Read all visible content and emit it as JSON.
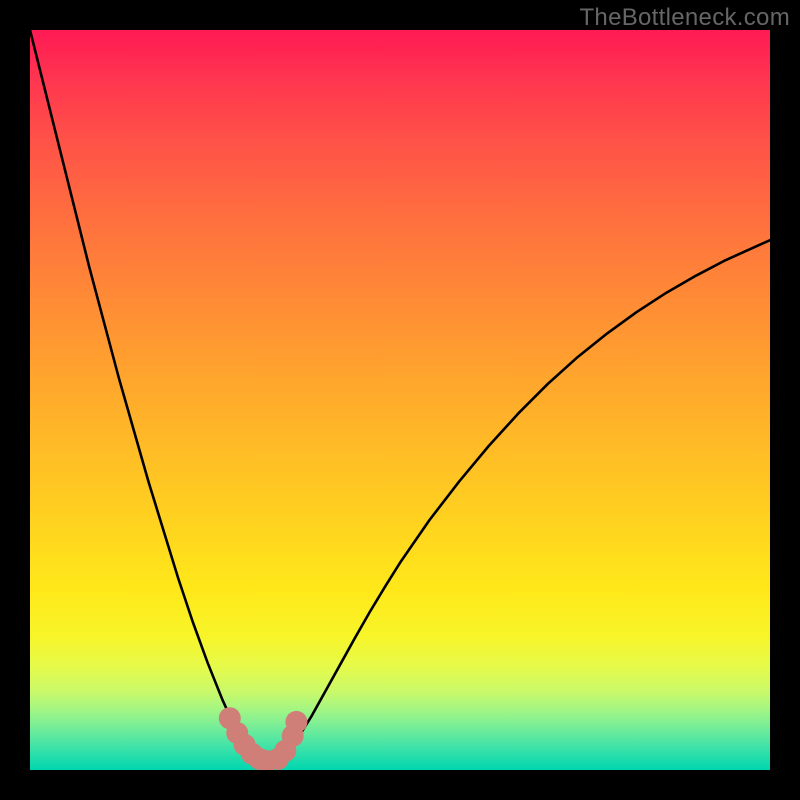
{
  "attribution": "TheBottleneck.com",
  "chart_data": {
    "type": "line",
    "title": "",
    "xlabel": "",
    "ylabel": "",
    "xlim": [
      0,
      100
    ],
    "ylim": [
      0,
      100
    ],
    "x": [
      0,
      2,
      4,
      6,
      8,
      10,
      12,
      14,
      16,
      18,
      20,
      22,
      24,
      25,
      26,
      27,
      28,
      29,
      30,
      31,
      32,
      33,
      34,
      36,
      38,
      40,
      42,
      44,
      46,
      48,
      50,
      54,
      58,
      62,
      66,
      70,
      74,
      78,
      82,
      86,
      90,
      94,
      98,
      100
    ],
    "y": [
      100,
      92,
      84,
      76,
      68,
      60.5,
      53,
      46,
      39,
      32.5,
      26,
      20,
      14.5,
      12,
      9.5,
      7.3,
      5.4,
      3.8,
      2.6,
      1.7,
      1.2,
      1.2,
      1.8,
      4.0,
      7.2,
      10.8,
      14.4,
      18.0,
      21.5,
      24.8,
      28.0,
      33.8,
      39.0,
      43.8,
      48.2,
      52.2,
      55.8,
      59.0,
      61.9,
      64.5,
      66.8,
      68.9,
      70.7,
      71.6
    ],
    "series_color": "#000000",
    "markers": {
      "color": "#cf7f78",
      "points": [
        {
          "x": 27,
          "y": 7.0
        },
        {
          "x": 28,
          "y": 5.0
        },
        {
          "x": 29,
          "y": 3.4
        },
        {
          "x": 30,
          "y": 2.2
        },
        {
          "x": 31,
          "y": 1.5
        },
        {
          "x": 32,
          "y": 1.2
        },
        {
          "x": 33.5,
          "y": 1.5
        },
        {
          "x": 34.5,
          "y": 2.6
        },
        {
          "x": 35.5,
          "y": 4.6
        },
        {
          "x": 36.0,
          "y": 6.5
        }
      ]
    },
    "gradient_stops": [
      {
        "pct": 0,
        "color": "#ff1a54"
      },
      {
        "pct": 15,
        "color": "#ff5248"
      },
      {
        "pct": 36,
        "color": "#ff8a36"
      },
      {
        "pct": 58,
        "color": "#ffbf25"
      },
      {
        "pct": 76,
        "color": "#ffe91a"
      },
      {
        "pct": 89.5,
        "color": "#c8f96a"
      },
      {
        "pct": 97,
        "color": "#3de2a8"
      },
      {
        "pct": 100,
        "color": "#00d6b0"
      }
    ]
  }
}
